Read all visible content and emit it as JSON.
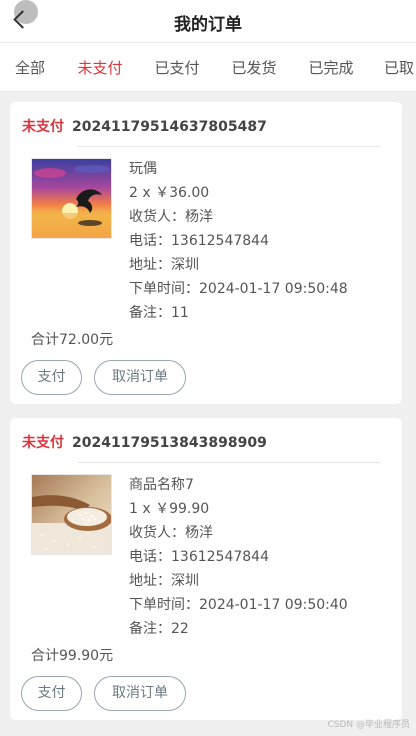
{
  "header": {
    "title": "我的订单",
    "back_icon": "chevron-left-icon"
  },
  "tabs": [
    {
      "label": "全部",
      "active": false
    },
    {
      "label": "未支付",
      "active": true
    },
    {
      "label": "已支付",
      "active": false
    },
    {
      "label": "已发货",
      "active": false
    },
    {
      "label": "已完成",
      "active": false
    },
    {
      "label": "已取",
      "active": false
    }
  ],
  "orders": [
    {
      "status": "未支付",
      "order_no": "20241179514637805487",
      "product_name": "玩偶",
      "qty_price": "2 x ￥36.00",
      "receiver": "收货人：杨洋",
      "phone": "电话：13612547844",
      "address": "地址：深圳",
      "order_time": "下单时间：2024-01-17 09:50:48",
      "remark": "备注：11",
      "total": "合计72.00元",
      "pay_label": "支付",
      "cancel_label": "取消订单"
    },
    {
      "status": "未支付",
      "order_no": "20241179513843898909",
      "product_name": "商品名称7",
      "qty_price": "1 x ￥99.90",
      "receiver": "收货人：杨洋",
      "phone": "电话：13612547844",
      "address": "地址：深圳",
      "order_time": "下单时间：2024-01-17 09:50:40",
      "remark": "备注：22",
      "total": "合计99.90元",
      "pay_label": "支付",
      "cancel_label": "取消订单"
    }
  ],
  "watermark": "CSDN @毕业程序员",
  "colors": {
    "accent": "#d9363e",
    "background": "#f0f0f0",
    "button_border": "#9aa6ad"
  }
}
